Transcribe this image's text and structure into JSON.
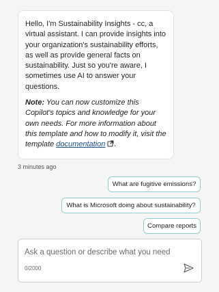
{
  "message": {
    "intro": "Hello, I'm Sustainability Insights - cc, a virtual assistant. I can provide insights into your organization's sustainability efforts, as well as provide general facts on sustainability. Just so you're aware, I sometimes use AI to answer your questions.",
    "note_label": "Note:",
    "note_text": " You can now customize this Copilot's topics and knowledge for your own needs. For more information about this template and how to modify it, visit the template ",
    "link_text": "documentation",
    "end": ".",
    "timestamp": "3 minutes ago"
  },
  "suggestions": [
    {
      "label": "What are fugitive emissions?"
    },
    {
      "label": "What is Microsoft doing about sustainability?"
    },
    {
      "label": "Compare reports"
    }
  ],
  "composer": {
    "placeholder": "Ask a question or describe what you need",
    "counter": "0/2000"
  },
  "icons": {
    "external_link": "external-link-icon",
    "send": "send-icon"
  },
  "colors": {
    "suggestion_border": "#8fcfd0",
    "link": "#1a4f9a"
  }
}
